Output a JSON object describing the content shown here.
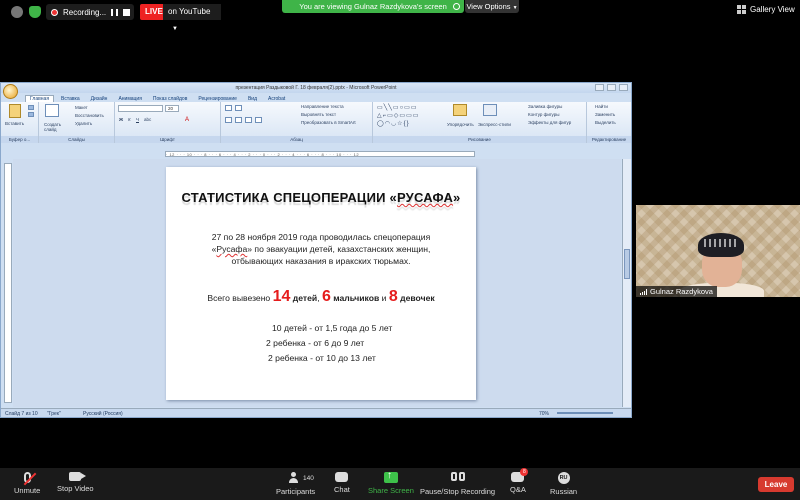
{
  "topbar": {
    "recording_label": "Recording...",
    "live_label": "LIVE",
    "youtube_label": "on YouTube",
    "viewing_text": "You are viewing Gulnaz Razdykova's screen",
    "view_options": "View Options",
    "gallery_view": "Gallery View"
  },
  "ppt": {
    "title": "презентация Раздыковой Г. 18 февраля(2).pptx - Microsoft PowerPoint",
    "tabs": [
      "Главная",
      "Вставка",
      "Дизайн",
      "Анимация",
      "Показ слайдов",
      "Рецензирование",
      "Вид",
      "Acrobat"
    ],
    "ribbon": {
      "paste": "Вставить",
      "create_slide": "Создать слайд",
      "layout": "Макет",
      "restore": "Восстановить",
      "delete": "Удалить",
      "font_size": "20",
      "text_direction": "Направление текста",
      "align_text": "Выровнять текст",
      "smartart": "Преобразовать в SmartArt",
      "arrange": "Упорядочить",
      "quick_styles": "Экспресс-стили",
      "shape_fill": "Заливка фигуры",
      "shape_outline": "Контур фигуры",
      "shape_effects": "Эффекты для фигур",
      "find": "Найти",
      "replace": "Заменить",
      "select": "Выделить",
      "groups": [
        "Буфер о...",
        "Слайды",
        "Шрифт",
        "Абзац",
        "Рисование",
        "Редактирование"
      ]
    },
    "status": {
      "slide": "Слайд 7 из 10",
      "theme": "\"Грек\"",
      "language": "Русский (Россия)",
      "zoom": "70%"
    }
  },
  "slide": {
    "title_pre": "СТАТИСТИКА СПЕЦОПЕРАЦИИ  «",
    "title_u": "РУСАФА",
    "title_post": "»",
    "p1_line1": "27 по 28  ноября 2019 года  проводилась спецоперация",
    "p1_line2_pre": "«",
    "p1_line2_u": "Русафа",
    "p1_line2_post": "» по эвакуации детей, казахстанских женщин,",
    "p1_line3": "отбывающих наказания в иракских тюрьмах.",
    "summary_pre": "Всего вывезено ",
    "n1": "14",
    "w1": " детей",
    "c1": ", ",
    "n2": "6",
    "w2": " мальчиков",
    "c2": " и ",
    "n3": "8",
    "w3": " девочек",
    "list": [
      "10 детей - от 1,5 года до 5 лет",
      "2 ребенка -  от  6 до 9 лет",
      "2 ребенка -  от 10 до 13 лет"
    ]
  },
  "participant": {
    "name": "Gulnaz Razdykova"
  },
  "toolbar": {
    "unmute": "Unmute",
    "stop_video": "Stop Video",
    "participants": "Participants",
    "participants_count": "140",
    "chat": "Chat",
    "share_screen": "Share Screen",
    "pause_recording": "Pause/Stop Recording",
    "qa": "Q&A",
    "qa_badge": "8",
    "language_code": "RU",
    "language": "Russian",
    "leave": "Leave"
  },
  "colors": {
    "accent_green": "#3fb448",
    "live_red": "#e22222",
    "slide_number_red": "#e51c1c",
    "leave_red": "#d73a2f"
  }
}
